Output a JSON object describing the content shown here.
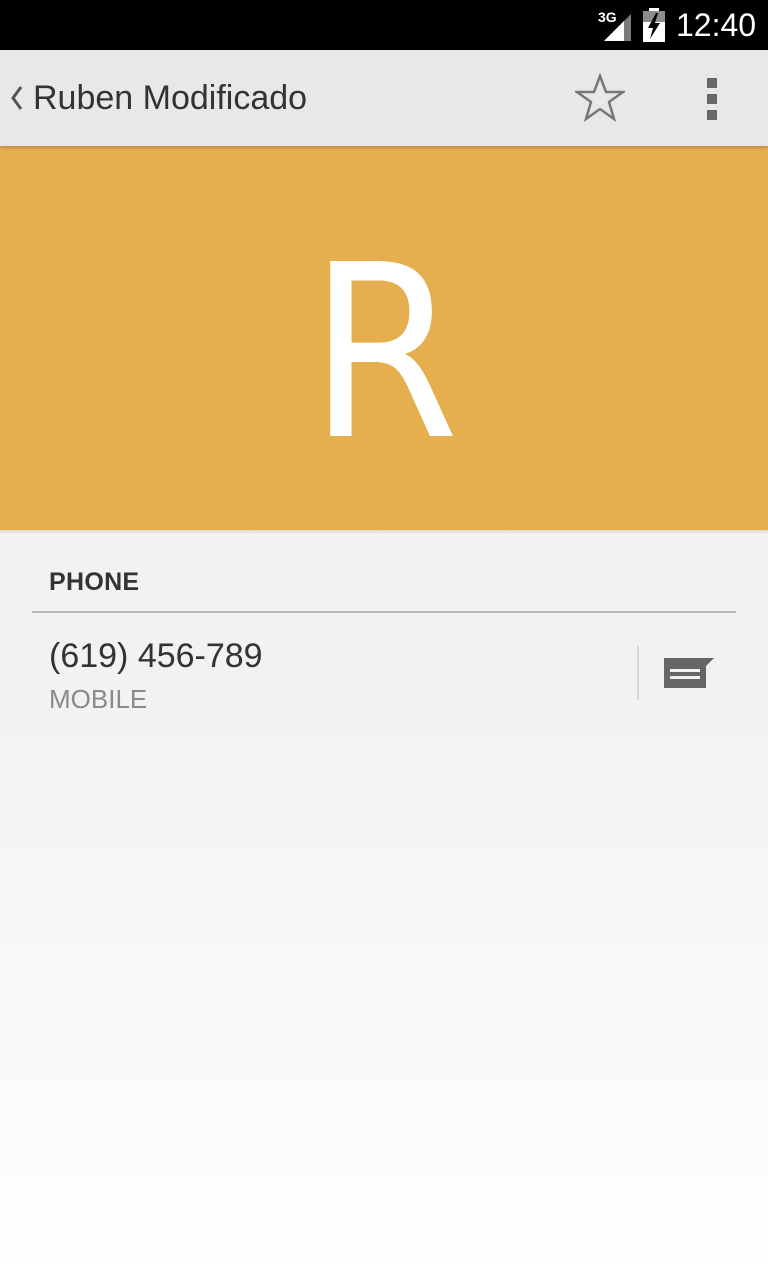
{
  "status_bar": {
    "network_label": "3G",
    "time": "12:40",
    "icons": [
      "signal-3g-icon",
      "battery-charging-icon"
    ]
  },
  "action_bar": {
    "up_icon": "chevron-left-icon",
    "title": "Ruben Modificado",
    "star_icon": "star-outline-icon",
    "overflow_icon": "overflow-menu-icon"
  },
  "header": {
    "letter": "R",
    "background_color": "#e5af4f"
  },
  "phone_section": {
    "title": "PHONE",
    "entries": [
      {
        "number": "(619) 456-789",
        "type": "MOBILE",
        "action_icon": "message-icon"
      }
    ]
  },
  "colors": {
    "accent": "#e5af4f",
    "status_bar": "#000000",
    "action_bar": "#e8e8e8",
    "text_primary": "#333333",
    "text_secondary": "#8a8a8a"
  }
}
